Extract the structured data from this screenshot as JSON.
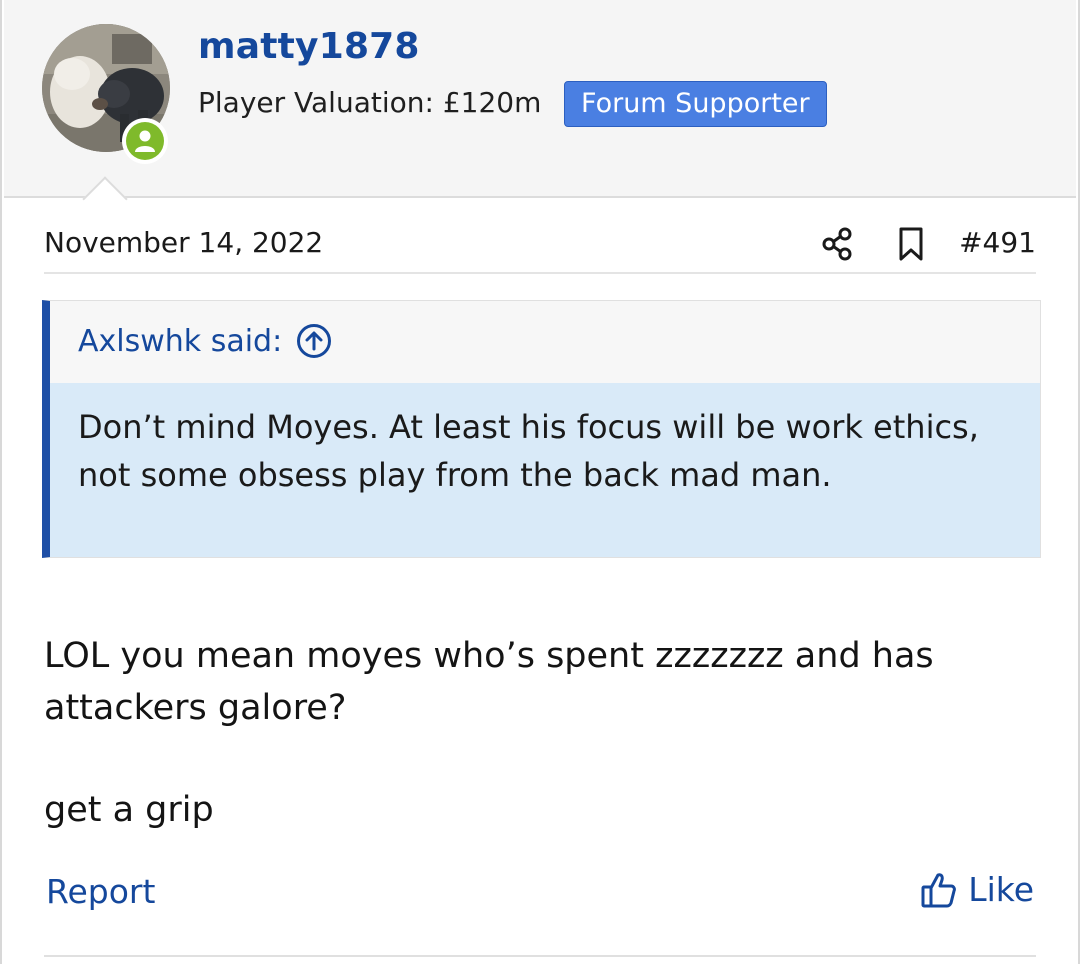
{
  "user": {
    "username": "matty1878",
    "valuation": "Player Valuation: £120m",
    "badge": "Forum Supporter",
    "online_status_icon": "user-online-icon",
    "avatar_icon": "avatar-dogs-photo"
  },
  "post": {
    "date": "November 14, 2022",
    "number": "#491",
    "share_icon": "share-icon",
    "bookmark_icon": "bookmark-icon",
    "quote": {
      "author": "Axlswhk said:",
      "jump_icon": "arrow-up-circle-icon",
      "text": "Don’t mind Moyes. At least his focus will be work ethics, not some obsess play from the back mad man."
    },
    "body": [
      "LOL you mean moyes who’s spent zzzzzzz and has attackers galore?",
      "get a grip"
    ]
  },
  "actions": {
    "report_label": "Report",
    "like_label": "Like",
    "like_icon": "thumbs-up-icon"
  },
  "colors": {
    "link": "#15489c",
    "badge_bg": "#4a7fe2",
    "online": "#7fba2b",
    "quote_bg": "#d9eaf8",
    "quote_border": "#1e4fa6"
  }
}
